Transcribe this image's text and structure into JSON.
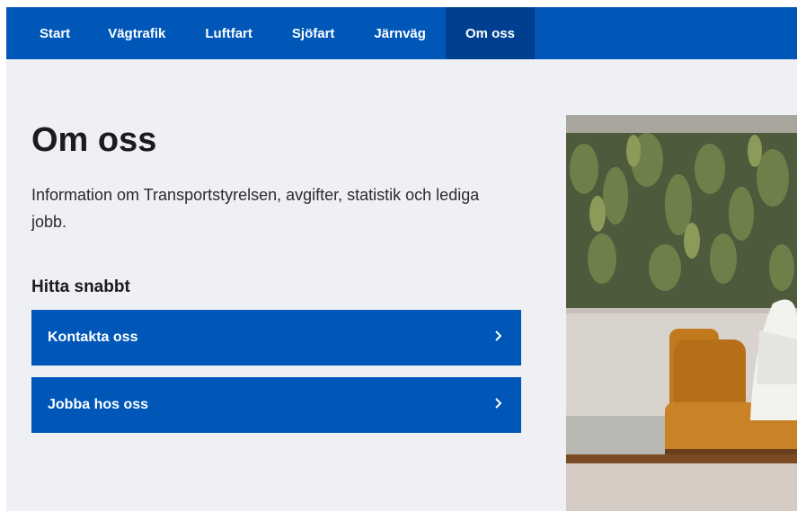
{
  "nav": {
    "items": [
      {
        "label": "Start"
      },
      {
        "label": "Vägtrafik"
      },
      {
        "label": "Luftfart"
      },
      {
        "label": "Sjöfart"
      },
      {
        "label": "Järnväg"
      },
      {
        "label": "Om oss"
      }
    ],
    "active_index": 5
  },
  "main": {
    "title": "Om oss",
    "intro": "Information om Transportstyrelsen, avgifter, statistik och lediga jobb.",
    "quick_heading": "Hitta snabbt",
    "quick_links": [
      {
        "label": "Kontakta oss",
        "icon": "chevron-right-icon"
      },
      {
        "label": "Jobba hos oss",
        "icon": "chevron-right-icon"
      }
    ]
  },
  "colors": {
    "brand_blue": "#0057b8",
    "active_nav": "#003f8f",
    "background": "#eef0f4"
  }
}
